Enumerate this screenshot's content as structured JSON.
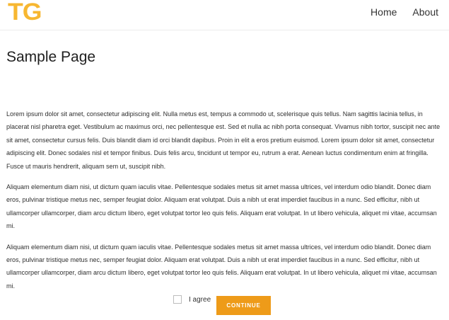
{
  "header": {
    "logo_text": "TG",
    "nav": [
      {
        "label": "Home"
      },
      {
        "label": "About"
      }
    ]
  },
  "page": {
    "title": "Sample Page",
    "paragraphs": [
      "Lorem ipsum dolor sit amet, consectetur adipiscing elit. Nulla metus est, tempus a commodo ut, scelerisque quis tellus. Nam sagittis lacinia tellus, in placerat nisl pharetra eget. Vestibulum ac maximus orci, nec pellentesque est. Sed et nulla ac nibh porta consequat. Vivamus nibh tortor, suscipit nec ante sit amet, consectetur cursus felis. Duis blandit diam id orci blandit dapibus. Proin in elit a eros pretium euismod. Lorem ipsum dolor sit amet, consectetur adipiscing elit. Donec sodales nisl et tempor finibus. Duis felis arcu, tincidunt ut tempor eu, rutrum a erat. Aenean luctus condimentum enim at fringilla. Fusce ut mauris hendrerit, aliquam sem ut, suscipit nibh.",
      "Aliquam elementum diam nisi, ut dictum quam iaculis vitae. Pellentesque sodales metus sit amet massa ultrices, vel interdum odio blandit. Donec diam eros, pulvinar tristique metus nec, semper feugiat dolor. Aliquam erat volutpat. Duis a nibh ut erat imperdiet faucibus in a nunc. Sed efficitur, nibh ut ullamcorper ullamcorper, diam arcu dictum libero, eget volutpat tortor leo quis felis. Aliquam erat volutpat. In ut libero vehicula, aliquet mi vitae, accumsan mi.",
      "Aliquam elementum diam nisi, ut dictum quam iaculis vitae. Pellentesque sodales metus sit amet massa ultrices, vel interdum odio blandit. Donec diam eros, pulvinar tristique metus nec, semper feugiat dolor. Aliquam erat volutpat. Duis a nibh ut erat imperdiet faucibus in a nunc. Sed efficitur, nibh ut ullamcorper ullamcorper, diam arcu dictum libero, eget volutpat tortor leo quis felis. Aliquam erat volutpat. In ut libero vehicula, aliquet mi vitae, accumsan mi."
    ]
  },
  "form": {
    "agree_label": "I agree",
    "agree_checked": false,
    "continue_label": "CONTINUE"
  },
  "colors": {
    "logo": "#f7b731",
    "button": "#ee9b19"
  }
}
